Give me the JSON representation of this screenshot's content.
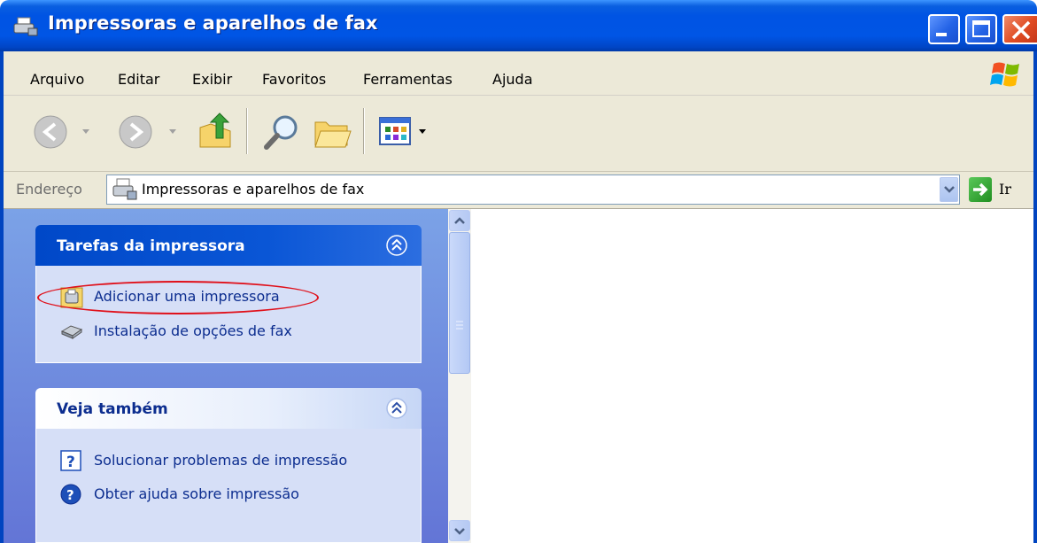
{
  "window": {
    "title": "Impressoras e aparelhos de fax"
  },
  "menu": {
    "items": [
      "Arquivo",
      "Editar",
      "Exibir",
      "Favoritos",
      "Ferramentas",
      "Ajuda"
    ]
  },
  "toolbar": {
    "buttons": [
      "back-icon",
      "forward-icon",
      "up-folder-icon",
      "search-icon",
      "folders-icon",
      "views-icon"
    ]
  },
  "address": {
    "label": "Endereço",
    "value": "Impressoras e aparelhos de fax",
    "go_label": "Ir"
  },
  "tasks_panel": {
    "printer_tasks": {
      "title": "Tarefas da impressora",
      "items": [
        "Adicionar uma impressora",
        "Instalação de opções de fax"
      ]
    },
    "see_also": {
      "title": "Veja também",
      "items": [
        "Solucionar problemas de impressão",
        "Obter ajuda sobre impressão"
      ]
    }
  },
  "colors": {
    "titlebar": "#0054e3",
    "menubar": "#ece9d8",
    "taskpane_top": "#7ba2e7",
    "taskpane_bottom": "#6375d6",
    "link": "#0c2d8f",
    "highlight": "#e0101a"
  }
}
